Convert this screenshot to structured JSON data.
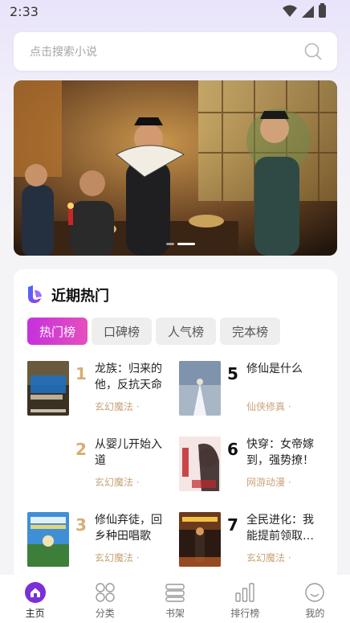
{
  "status": {
    "time": "2:33"
  },
  "search": {
    "placeholder": "点击搜索小说"
  },
  "hot": {
    "title": "近期热门",
    "tabs": [
      "热门榜",
      "口碑榜",
      "人气榜",
      "完本榜"
    ],
    "books": [
      {
        "rank": "1",
        "title": "龙族：归来的他，反抗天命",
        "genre": "玄幻魔法 ·"
      },
      {
        "rank": "2",
        "title": "从婴儿开始入道",
        "genre": "玄幻魔法 ·"
      },
      {
        "rank": "3",
        "title": "修仙弃徒，回乡种田唱歌",
        "genre": "玄幻魔法 ·"
      },
      {
        "rank": "5",
        "title": "修仙是什么",
        "genre": "仙侠修真 ·"
      },
      {
        "rank": "6",
        "title": "快穿：女帝嫁到，强势撩！",
        "genre": "网游动漫 ·"
      },
      {
        "rank": "7",
        "title": "全民进化：我能提前领取…",
        "genre": "玄幻魔法 ·"
      }
    ]
  },
  "tabbar": [
    "主页",
    "分类",
    "书架",
    "排行榜",
    "我的"
  ],
  "colors": {
    "accent": "#7b2fd6",
    "tab_active_start": "#c431dd",
    "tab_active_end": "#e64fbe",
    "genre": "#c9a37a",
    "rank_gold": "#d7ad73"
  }
}
